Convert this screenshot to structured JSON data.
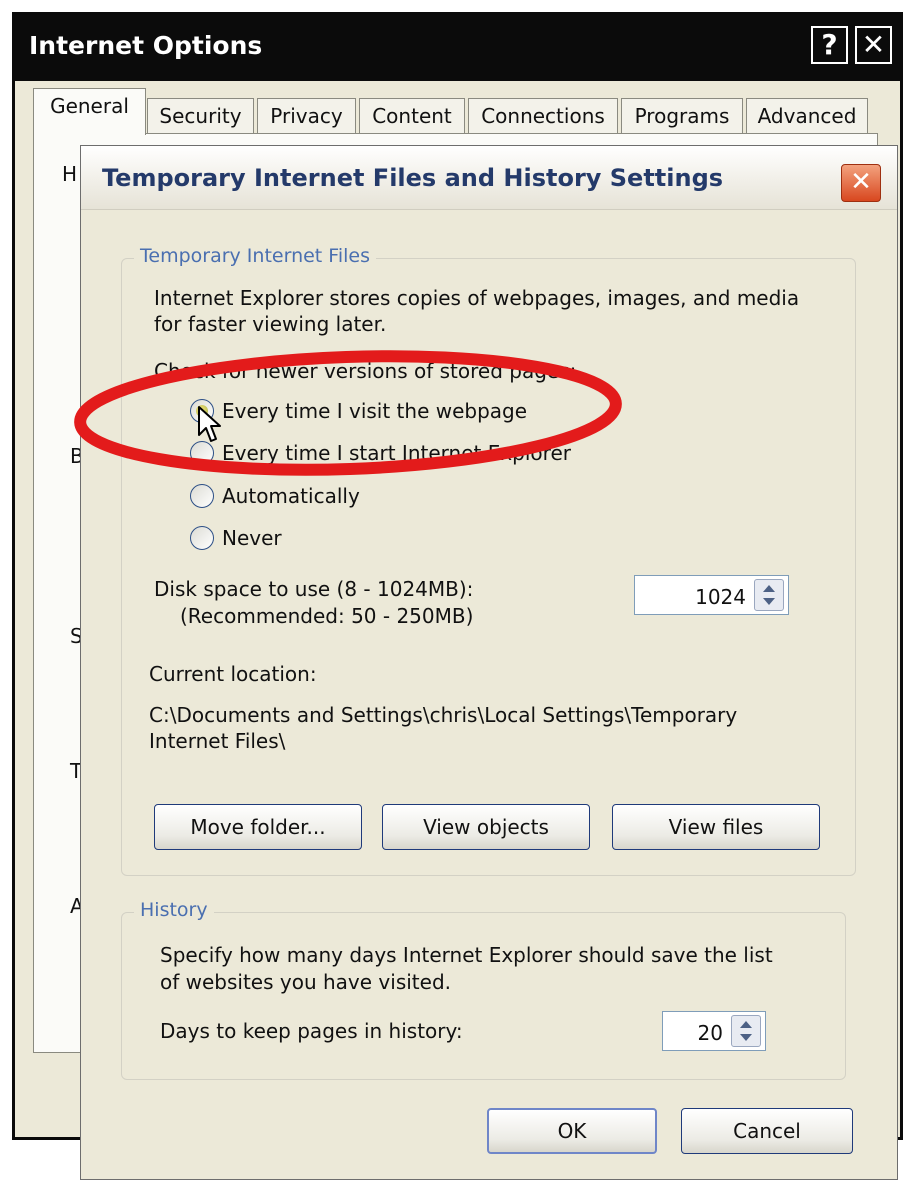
{
  "back_window": {
    "title": "Internet Options",
    "help_glyph": "?",
    "close_glyph": "✕",
    "tabs": [
      {
        "label": "General",
        "active": true
      },
      {
        "label": "Security"
      },
      {
        "label": "Privacy"
      },
      {
        "label": "Content"
      },
      {
        "label": "Connections"
      },
      {
        "label": "Programs"
      },
      {
        "label": "Advanced"
      }
    ],
    "peek_letters": [
      "H",
      "B",
      "S",
      "T",
      "A"
    ]
  },
  "dialog": {
    "title": "Temporary Internet Files and History Settings",
    "close_glyph": "✕",
    "temp_files": {
      "legend": "Temporary Internet Files",
      "description_lines": [
        "Internet Explorer stores copies of webpages, images, and media",
        "for faster viewing later."
      ],
      "check_label": "Check for newer versions of stored pages:",
      "options": [
        {
          "label": "Every time I visit the webpage",
          "selected": true
        },
        {
          "label": "Every time I start Internet Explorer",
          "selected": false
        },
        {
          "label": "Automatically",
          "selected": false
        },
        {
          "label": "Never",
          "selected": false
        }
      ],
      "disk_label": "Disk space to use (8 - 1024MB):",
      "disk_recommended": "(Recommended: 50 - 250MB)",
      "disk_value": "1024",
      "location_label": "Current location:",
      "location_lines": [
        "C:\\Documents and Settings\\chris\\Local Settings\\Temporary",
        "Internet Files\\"
      ],
      "buttons": {
        "move_folder": "Move folder...",
        "view_objects": "View objects",
        "view_files": "View files"
      }
    },
    "history": {
      "legend": "History",
      "description_lines": [
        "Specify how many days Internet Explorer should save the list",
        "of websites you have visited."
      ],
      "days_label": "Days to keep pages in history:",
      "days_value": "20"
    },
    "ok_label": "OK",
    "cancel_label": "Cancel"
  },
  "colors": {
    "annotation_ellipse": "#e31b1b",
    "legend_text": "#4a6fb0",
    "titlebar_back": "#0b0b0b",
    "close_button": "#d8471f"
  }
}
